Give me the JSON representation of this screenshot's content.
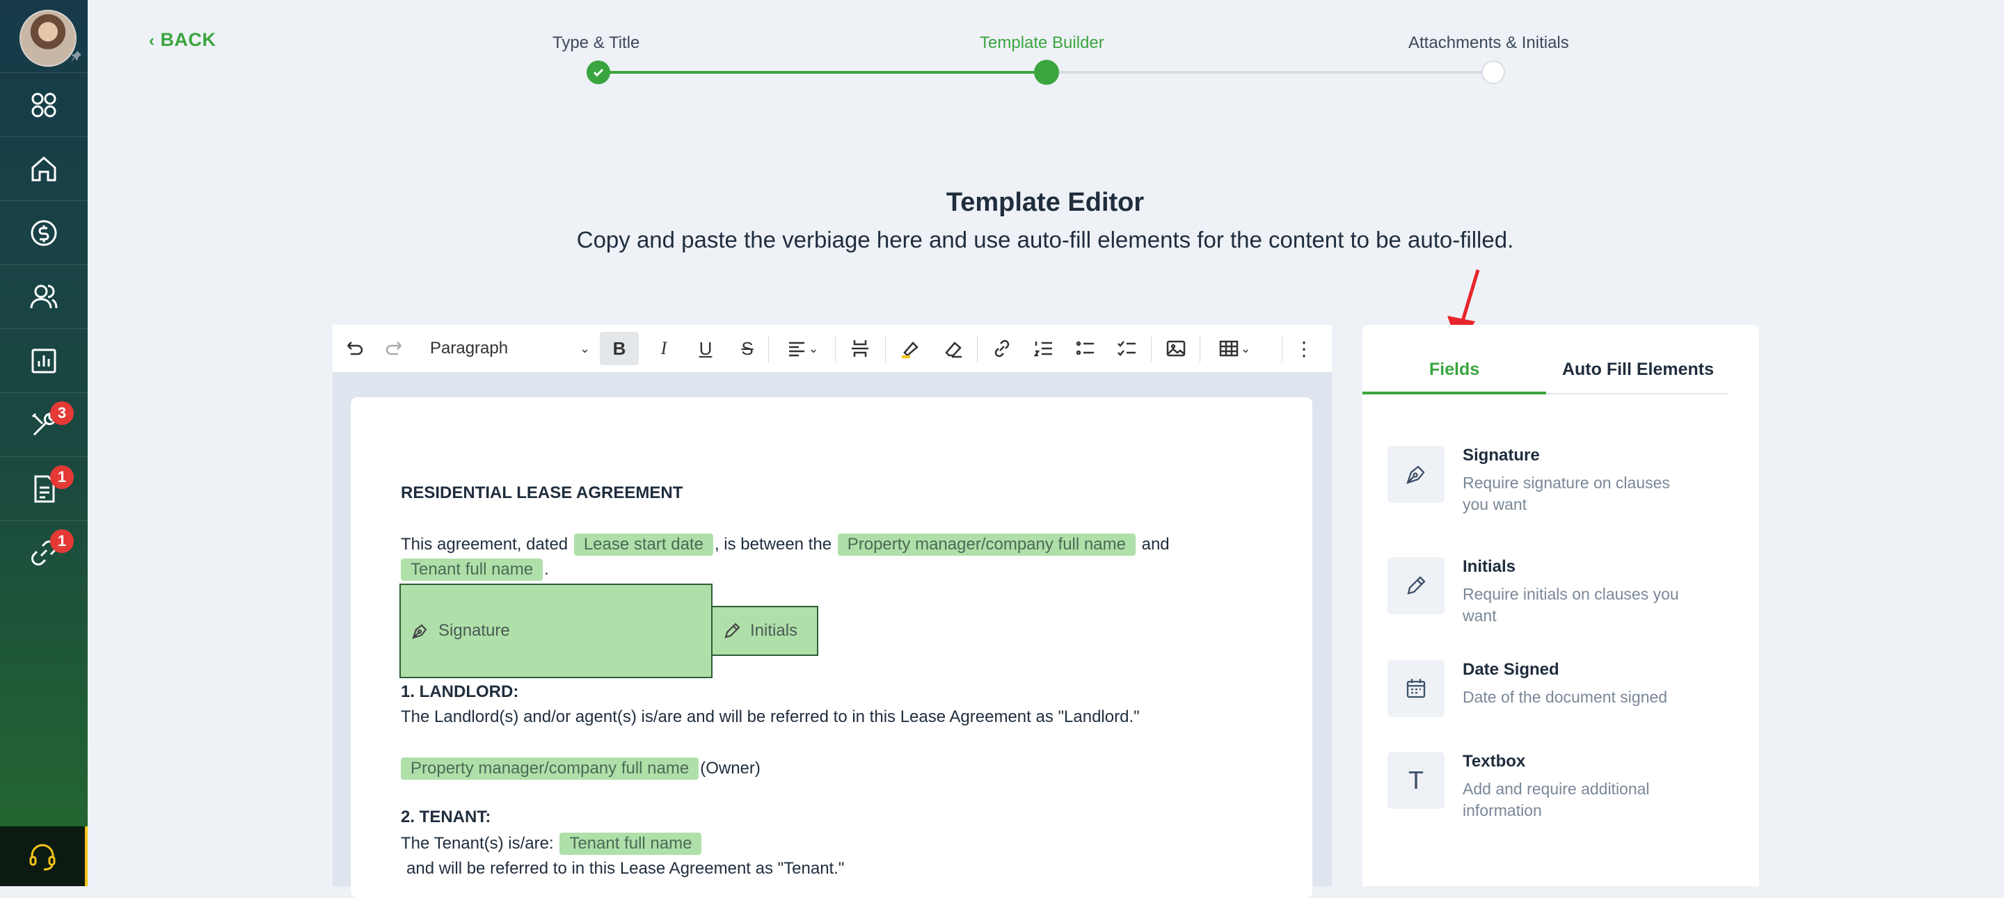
{
  "nav": {
    "back_label": "BACK",
    "badges": {
      "tools": "3",
      "docs": "1",
      "links": "1"
    }
  },
  "steps": [
    {
      "label": "Type & Title",
      "state": "done"
    },
    {
      "label": "Template Builder",
      "state": "active"
    },
    {
      "label": "Attachments & Initials",
      "state": "pending"
    }
  ],
  "header": {
    "title": "Template Editor",
    "subtitle": "Copy and paste the verbiage here and use auto-fill elements for the content to be auto-filled."
  },
  "toolbar": {
    "block_style": "Paragraph",
    "bold": "B",
    "italic": "I",
    "underline": "U",
    "strike": "S"
  },
  "document": {
    "heading": "RESIDENTIAL LEASE AGREEMENT",
    "p1_a": "This agreement, dated",
    "chip_lease_start": "Lease start date",
    "p1_b": ", is between the",
    "chip_pm_name": "Property manager/company full name",
    "p1_c": "and",
    "chip_tenant_name": "Tenant full name",
    "p1_d": ".",
    "signature_box": "Signature",
    "initials_box": "Initials",
    "section1_title": "1. LANDLORD:",
    "section1_text": "The Landlord(s) and/or agent(s) is/are and will be referred to in this Lease Agreement as \"Landlord.\"",
    "owner_chip": "Property manager/company full name",
    "owner_suffix": "(Owner)",
    "section2_title": "2. TENANT:",
    "section2_text_a": "The Tenant(s) is/are:",
    "tenant_chip": "Tenant full name",
    "section2_text_b": "and will be referred to in this Lease Agreement as \"Tenant.\""
  },
  "panel": {
    "tabs": [
      {
        "label": "Fields",
        "active": true
      },
      {
        "label": "Auto Fill Elements",
        "active": false
      }
    ],
    "fields": [
      {
        "title": "Signature",
        "description": "Require signature on clauses you want",
        "icon": "pen-nib-icon"
      },
      {
        "title": "Initials",
        "description": "Require initials on clauses you want",
        "icon": "pencil-icon"
      },
      {
        "title": "Date Signed",
        "description": "Date of the document signed",
        "icon": "calendar-icon"
      },
      {
        "title": "Textbox",
        "description": "Add and require additional information",
        "icon": "text-T-icon"
      }
    ]
  },
  "colors": {
    "accent_green": "#3aa53f",
    "chip_green": "#b0e0aa",
    "annotation_arrow": "#e8252a"
  }
}
